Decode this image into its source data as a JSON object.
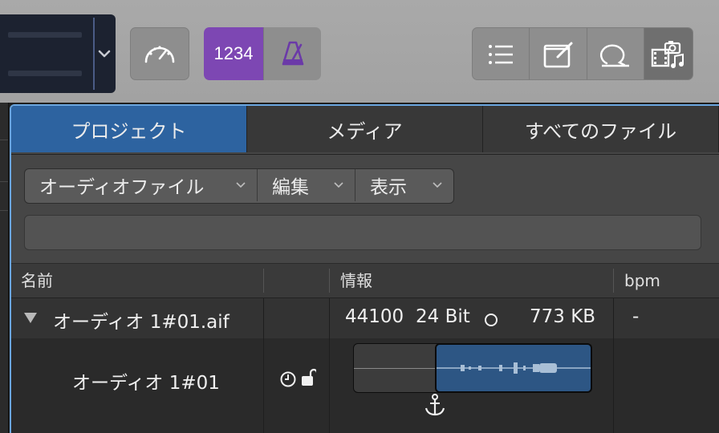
{
  "toolbar": {
    "lcd_menu_icon": "chevron-down-icon",
    "cpu_meter_icon": "gauge-icon",
    "count_in_label": "1234",
    "metronome_icon": "metronome-icon",
    "right_buttons": [
      "list-editors-icon",
      "note-pad-icon",
      "loop-browser-icon",
      "media-browser-icon"
    ],
    "colors": {
      "count_in_active": "#7d47b3",
      "toolbar_bg": "#a6a6a6"
    }
  },
  "browser": {
    "tabs": [
      {
        "label": "プロジェクト",
        "active": true
      },
      {
        "label": "メディア",
        "active": false
      },
      {
        "label": "すべてのファイル",
        "active": false
      }
    ],
    "dropdowns": {
      "audio_file": "オーディオファイル",
      "edit": "編集",
      "view": "表示"
    },
    "search": {
      "placeholder": "",
      "value": ""
    },
    "columns": {
      "name": "名前",
      "status": "",
      "info": "情報",
      "bpm": "bpm"
    },
    "rows": [
      {
        "name": "オーディオ 1#01.aif",
        "sample_rate": "44100",
        "bit_depth": "24 Bit",
        "channel_icon": "mono-circle-icon",
        "size": "773 KB",
        "bpm": "-"
      }
    ],
    "region": {
      "name": "オーディオ 1#01",
      "icons": [
        "clock-icon",
        "unlock-icon"
      ],
      "anchor_icon": "anchor-icon",
      "colors": {
        "region": "#2d5684",
        "accent": "#6aa5df"
      }
    }
  }
}
